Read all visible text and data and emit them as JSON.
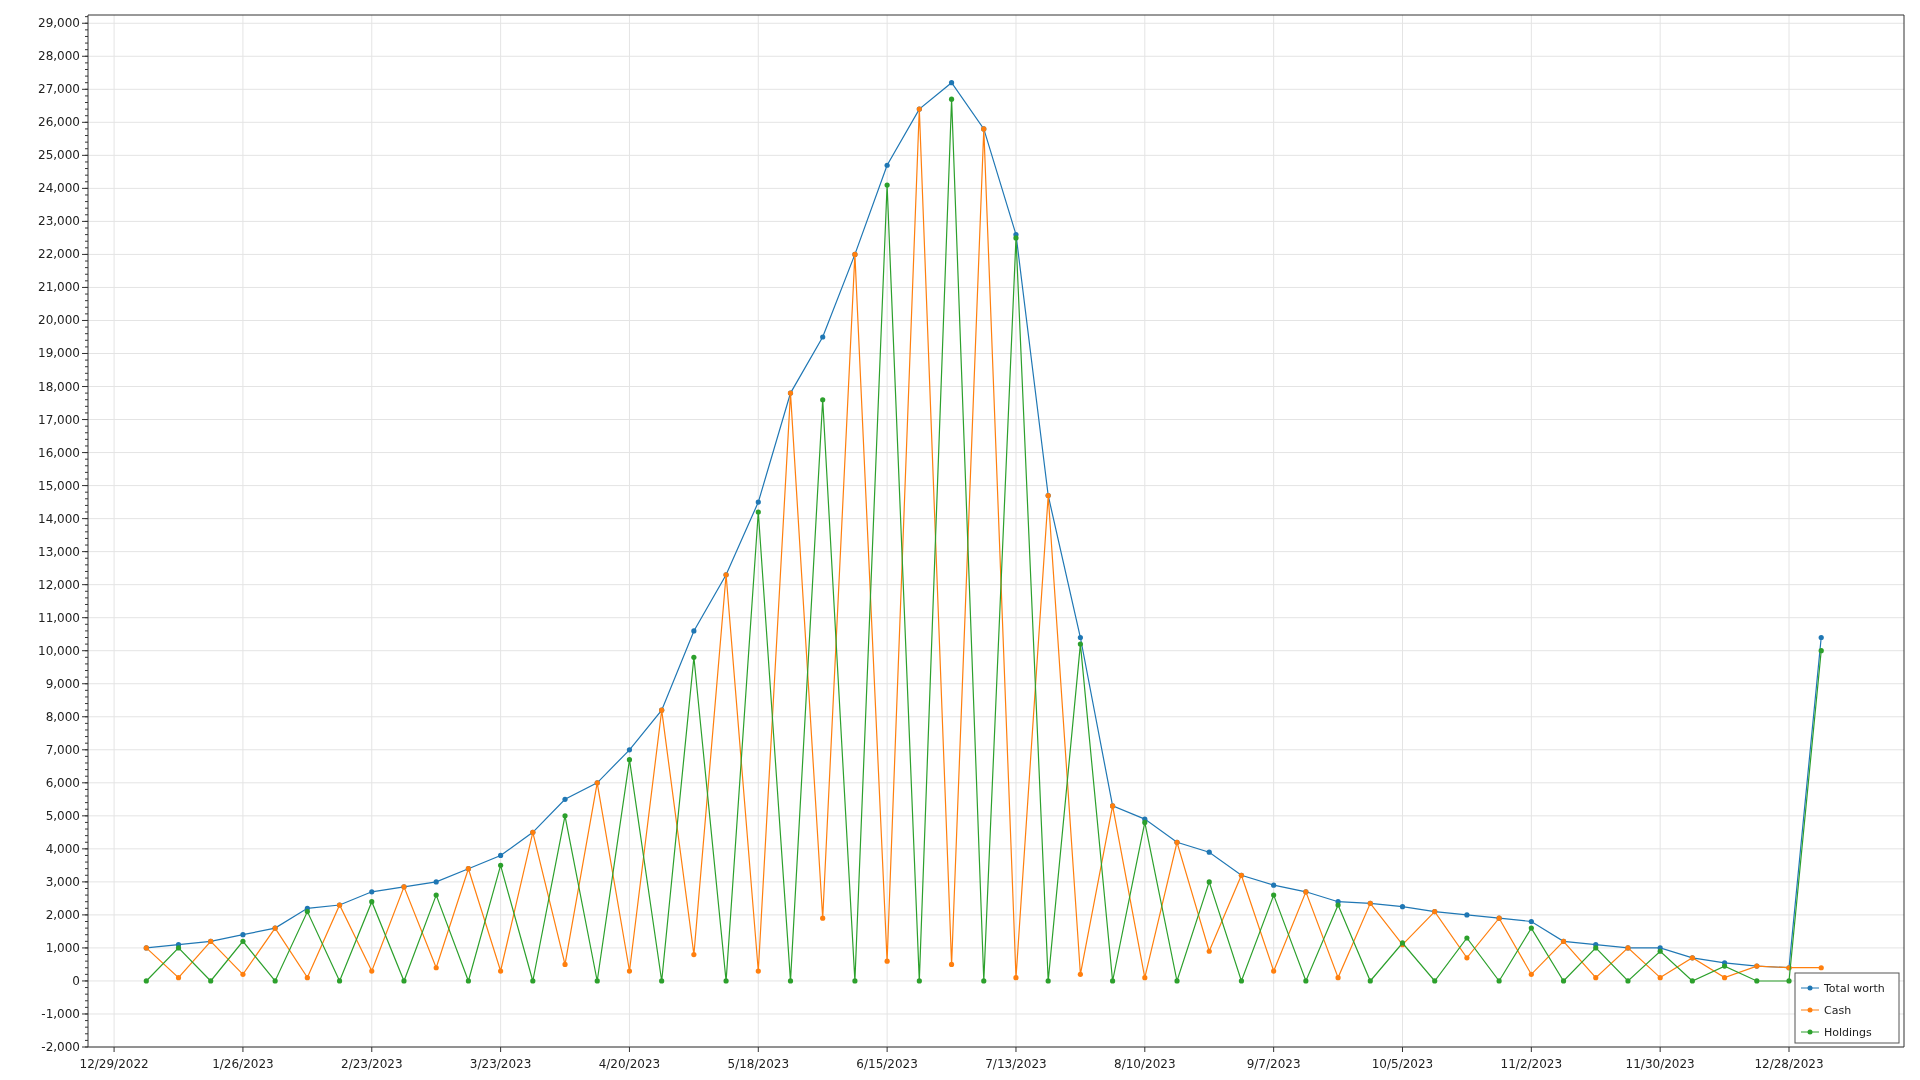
{
  "chart_data": {
    "type": "line",
    "grid": true,
    "legend": "lower right",
    "ylim": [
      -2000,
      29250
    ],
    "categories": [
      "12/29/2022",
      null,
      null,
      null,
      "1/26/2023",
      null,
      null,
      null,
      "2/23/2023",
      null,
      null,
      null,
      "3/23/2023",
      null,
      null,
      null,
      "4/20/2023",
      null,
      null,
      null,
      "5/18/2023",
      null,
      null,
      null,
      "6/15/2023",
      null,
      null,
      null,
      "7/13/2023",
      null,
      null,
      null,
      "8/10/2023",
      null,
      null,
      null,
      "9/7/2023",
      null,
      null,
      null,
      "10/5/2023",
      null,
      null,
      null,
      "11/2/2023",
      null,
      null,
      null,
      "11/30/2023",
      null,
      null,
      null,
      "12/28/2023",
      null
    ],
    "series": [
      {
        "name": "Total worth",
        "color": "#1f77b4",
        "values": [
          null,
          1000,
          1100,
          1200,
          1400,
          1600,
          2200,
          2300,
          2700,
          2850,
          3000,
          3400,
          3800,
          4500,
          5500,
          6000,
          7000,
          8200,
          10600,
          12300,
          14500,
          17800,
          19500,
          22000,
          24700,
          26400,
          27200,
          25800,
          22600,
          14700,
          10400,
          5300,
          4900,
          4200,
          3900,
          3200,
          2900,
          2700,
          2400,
          2350,
          2250,
          2100,
          2000,
          1900,
          1800,
          1200,
          1100,
          1000,
          1000,
          700,
          550,
          450,
          400,
          10400
        ]
      },
      {
        "name": "Cash",
        "color": "#ff7f0e",
        "values": [
          null,
          1000,
          100,
          1200,
          200,
          1600,
          100,
          2300,
          300,
          2850,
          400,
          3400,
          300,
          4500,
          500,
          6000,
          300,
          8200,
          800,
          12300,
          300,
          17800,
          1900,
          22000,
          600,
          26400,
          500,
          25800,
          100,
          14700,
          200,
          5300,
          100,
          4200,
          900,
          3200,
          300,
          2700,
          100,
          2350,
          1100,
          2100,
          700,
          1900,
          200,
          1200,
          100,
          1000,
          100,
          700,
          100,
          450,
          400,
          400
        ]
      },
      {
        "name": "Holdings",
        "color": "#2ca02c",
        "values": [
          null,
          0,
          1000,
          0,
          1200,
          0,
          2100,
          0,
          2400,
          0,
          2600,
          0,
          3500,
          0,
          5000,
          0,
          6700,
          0,
          9800,
          0,
          14200,
          0,
          17600,
          0,
          24100,
          0,
          26700,
          0,
          22500,
          0,
          10200,
          0,
          4800,
          0,
          3000,
          0,
          2600,
          0,
          2300,
          0,
          1150,
          0,
          1300,
          0,
          1600,
          0,
          1000,
          0,
          900,
          0,
          450,
          0,
          0,
          10000
        ]
      }
    ],
    "yticks": [
      {
        "value": -2000,
        "label": "-2,000"
      },
      {
        "value": -1000,
        "label": "-1,000"
      },
      {
        "value": 0,
        "label": "0"
      },
      {
        "value": 1000,
        "label": "1,000"
      },
      {
        "value": 2000,
        "label": "2,000"
      },
      {
        "value": 3000,
        "label": "3,000"
      },
      {
        "value": 4000,
        "label": "4,000"
      },
      {
        "value": 5000,
        "label": "5,000"
      },
      {
        "value": 6000,
        "label": "6,000"
      },
      {
        "value": 7000,
        "label": "7,000"
      },
      {
        "value": 8000,
        "label": "8,000"
      },
      {
        "value": 9000,
        "label": "9,000"
      },
      {
        "value": 10000,
        "label": "10,000"
      },
      {
        "value": 11000,
        "label": "11,000"
      },
      {
        "value": 12000,
        "label": "12,000"
      },
      {
        "value": 13000,
        "label": "13,000"
      },
      {
        "value": 14000,
        "label": "14,000"
      },
      {
        "value": 15000,
        "label": "15,000"
      },
      {
        "value": 16000,
        "label": "16,000"
      },
      {
        "value": 17000,
        "label": "17,000"
      },
      {
        "value": 18000,
        "label": "18,000"
      },
      {
        "value": 19000,
        "label": "19,000"
      },
      {
        "value": 20000,
        "label": "20,000"
      },
      {
        "value": 21000,
        "label": "21,000"
      },
      {
        "value": 22000,
        "label": "22,000"
      },
      {
        "value": 23000,
        "label": "23,000"
      },
      {
        "value": 24000,
        "label": "24,000"
      },
      {
        "value": 25000,
        "label": "25,000"
      },
      {
        "value": 26000,
        "label": "26,000"
      },
      {
        "value": 27000,
        "label": "27,000"
      },
      {
        "value": 28000,
        "label": "28,000"
      },
      {
        "value": 29000,
        "label": "29,000"
      }
    ]
  }
}
